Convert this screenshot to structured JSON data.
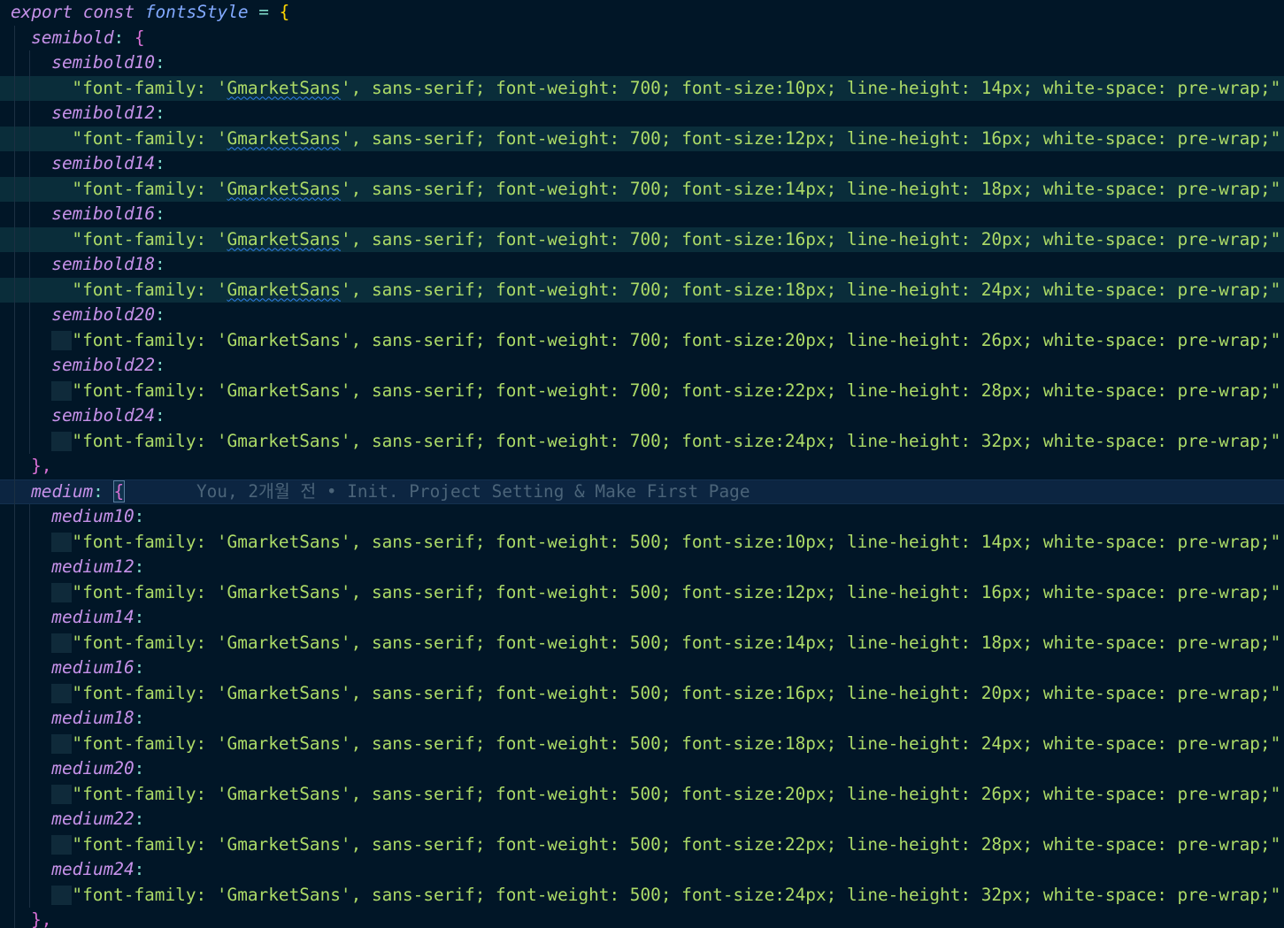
{
  "editor": {
    "decl_keywords": [
      "export",
      "const"
    ],
    "var_name": "fontsStyle",
    "assign": " = ",
    "open_brace": "{",
    "groups": [
      {
        "name": "semibold",
        "weight": "700",
        "entries": [
          {
            "key": "semibold10",
            "value": "\"font-family: 'GmarketSans', sans-serif; font-weight: 700; font-size:10px; line-height: 14px; white-space: pre-wrap;\","
          },
          {
            "key": "semibold12",
            "value": "\"font-family: 'GmarketSans', sans-serif; font-weight: 700; font-size:12px; line-height: 16px; white-space: pre-wrap;\","
          },
          {
            "key": "semibold14",
            "value": "\"font-family: 'GmarketSans', sans-serif; font-weight: 700; font-size:14px; line-height: 18px; white-space: pre-wrap;\","
          },
          {
            "key": "semibold16",
            "value": "\"font-family: 'GmarketSans', sans-serif; font-weight: 700; font-size:16px; line-height: 20px; white-space: pre-wrap;\","
          },
          {
            "key": "semibold18",
            "value": "\"font-family: 'GmarketSans', sans-serif; font-weight: 700; font-size:18px; line-height: 24px; white-space: pre-wrap;\","
          },
          {
            "key": "semibold20",
            "value": "\"font-family: 'GmarketSans', sans-serif; font-weight: 700; font-size:20px; line-height: 26px; white-space: pre-wrap;\","
          },
          {
            "key": "semibold22",
            "value": "\"font-family: 'GmarketSans', sans-serif; font-weight: 700; font-size:22px; line-height: 28px; white-space: pre-wrap;\","
          },
          {
            "key": "semibold24",
            "value": "\"font-family: 'GmarketSans', sans-serif; font-weight: 700; font-size:24px; line-height: 32px; white-space: pre-wrap;\","
          }
        ]
      },
      {
        "name": "medium",
        "weight": "500",
        "entries": [
          {
            "key": "medium10",
            "value": "\"font-family: 'GmarketSans', sans-serif; font-weight: 500; font-size:10px; line-height: 14px; white-space: pre-wrap;\","
          },
          {
            "key": "medium12",
            "value": "\"font-family: 'GmarketSans', sans-serif; font-weight: 500; font-size:12px; line-height: 16px; white-space: pre-wrap;\","
          },
          {
            "key": "medium14",
            "value": "\"font-family: 'GmarketSans', sans-serif; font-weight: 500; font-size:14px; line-height: 18px; white-space: pre-wrap;\","
          },
          {
            "key": "medium16",
            "value": "\"font-family: 'GmarketSans', sans-serif; font-weight: 500; font-size:16px; line-height: 20px; white-space: pre-wrap;\","
          },
          {
            "key": "medium18",
            "value": "\"font-family: 'GmarketSans', sans-serif; font-weight: 500; font-size:18px; line-height: 24px; white-space: pre-wrap;\","
          },
          {
            "key": "medium20",
            "value": "\"font-family: 'GmarketSans', sans-serif; font-weight: 500; font-size:20px; line-height: 26px; white-space: pre-wrap;\","
          },
          {
            "key": "medium22",
            "value": "\"font-family: 'GmarketSans', sans-serif; font-weight: 500; font-size:22px; line-height: 28px; white-space: pre-wrap;\","
          },
          {
            "key": "medium24",
            "value": "\"font-family: 'GmarketSans', sans-serif; font-weight: 500; font-size:24px; line-height: 32px; white-space: pre-wrap;\","
          }
        ]
      }
    ],
    "group_close": "},",
    "blame_text": "You, 2개월 전 • Init. Project Setting & Make First Page",
    "colors": {
      "background": "#011627",
      "keyword": "#c792ea",
      "identifier": "#82aaff",
      "string": "#addb67",
      "punctuation": "#7fdbca",
      "brace": "#ffd700",
      "blame": "#4b6479"
    }
  }
}
